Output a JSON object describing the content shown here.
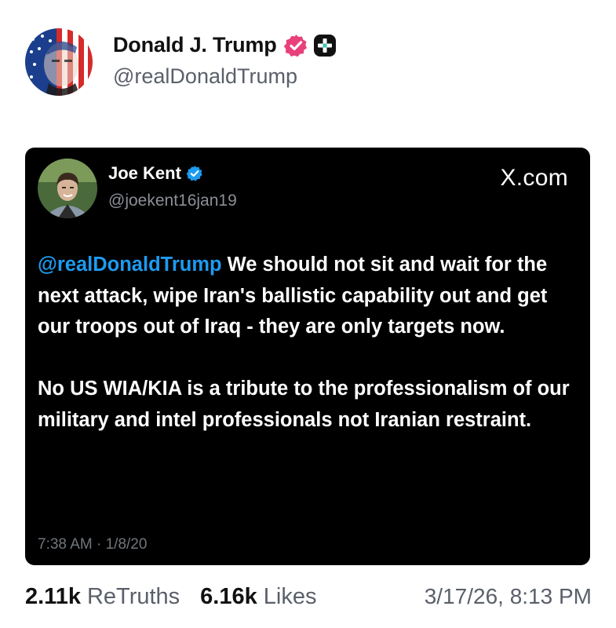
{
  "post": {
    "display_name": "Donald J. Trump",
    "handle": "@realDonaldTrump",
    "avatar_icon": "flag-portrait-avatar",
    "badges": [
      "verified-badge-icon",
      "plus-badge-icon"
    ],
    "badge_colors": {
      "verified": "#e8407a",
      "plus_bg": "#111111"
    }
  },
  "embed": {
    "name": "Joe Kent",
    "handle": "@joekent16jan19",
    "source": "X.com",
    "mention": "@realDonaldTrump",
    "paragraph1": " We should not sit and wait for the next attack, wipe Iran's ballistic capability out and get our troops out of Iraq - they are only targets now.",
    "paragraph2": "No US WIA/KIA is a tribute to the professionalism of our military and intel professionals not Iranian restraint.",
    "timestamp": "7:38 AM · 1/8/20",
    "colors": {
      "background": "#000000",
      "mention": "#1d9bf0",
      "verified": "#1d9bf0"
    }
  },
  "stats": {
    "retruths_count": "2.11k",
    "retruths_label": "ReTruths",
    "likes_count": "6.16k",
    "likes_label": "Likes",
    "date": "3/17/26, 8:13 PM"
  }
}
